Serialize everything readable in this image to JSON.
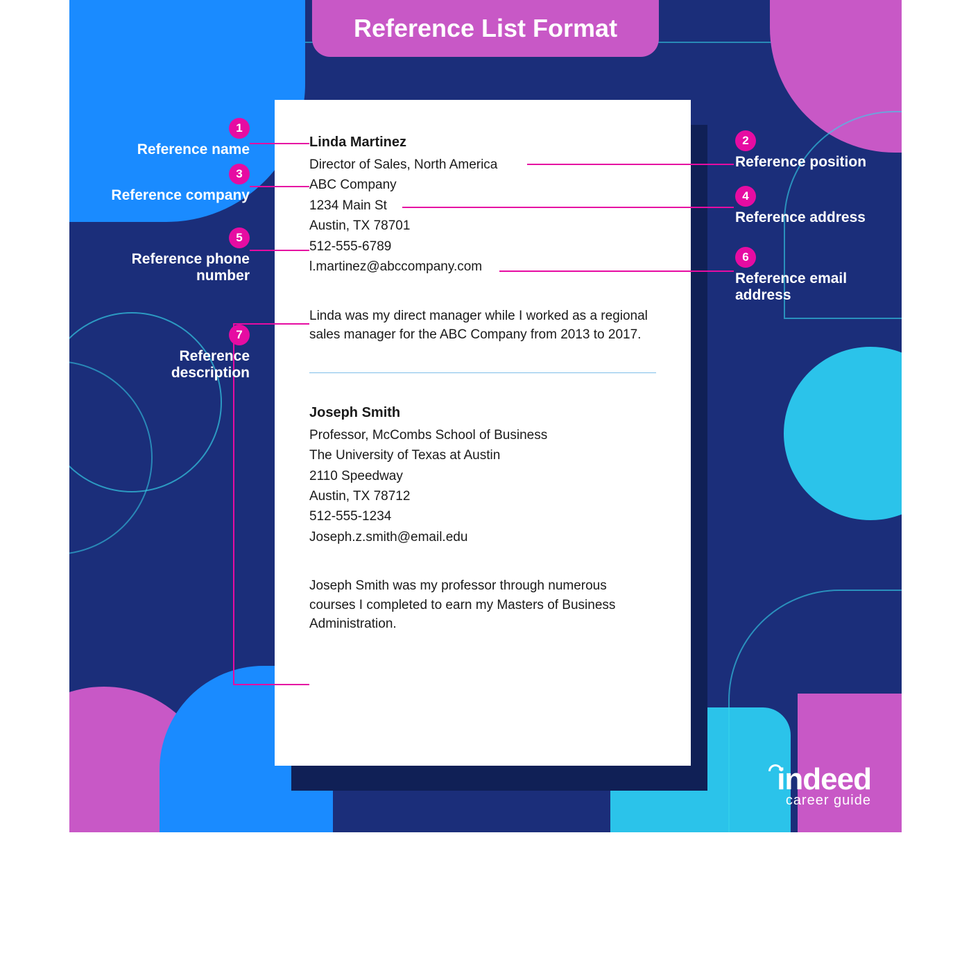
{
  "title": "Reference List Format",
  "callouts": [
    {
      "n": "1",
      "label": "Reference name"
    },
    {
      "n": "2",
      "label": "Reference position"
    },
    {
      "n": "3",
      "label": "Reference company"
    },
    {
      "n": "4",
      "label": "Reference address"
    },
    {
      "n": "5",
      "label": "Reference phone number"
    },
    {
      "n": "6",
      "label": "Reference email address"
    },
    {
      "n": "7",
      "label": "Reference description"
    }
  ],
  "references": [
    {
      "name": "Linda Martinez",
      "position": "Director of Sales, North America",
      "company": "ABC Company",
      "address1": "1234 Main St",
      "address2": "Austin, TX 78701",
      "phone": "512-555-6789",
      "email": "l.martinez@abccompany.com",
      "description": "Linda was my direct manager while I worked as a regional sales manager for the ABC Company from 2013 to 2017."
    },
    {
      "name": "Joseph Smith",
      "position": "Professor, McCombs School of Business",
      "company": "The University of Texas at Austin",
      "address1": "2110 Speedway",
      "address2": "Austin, TX 78712",
      "phone": "512-555-1234",
      "email": "Joseph.z.smith@email.edu",
      "description": "Joseph Smith was my professor through numerous courses I completed to earn my Masters of Business Administration."
    }
  ],
  "logo": {
    "main": "indeed",
    "sub": "career guide"
  }
}
